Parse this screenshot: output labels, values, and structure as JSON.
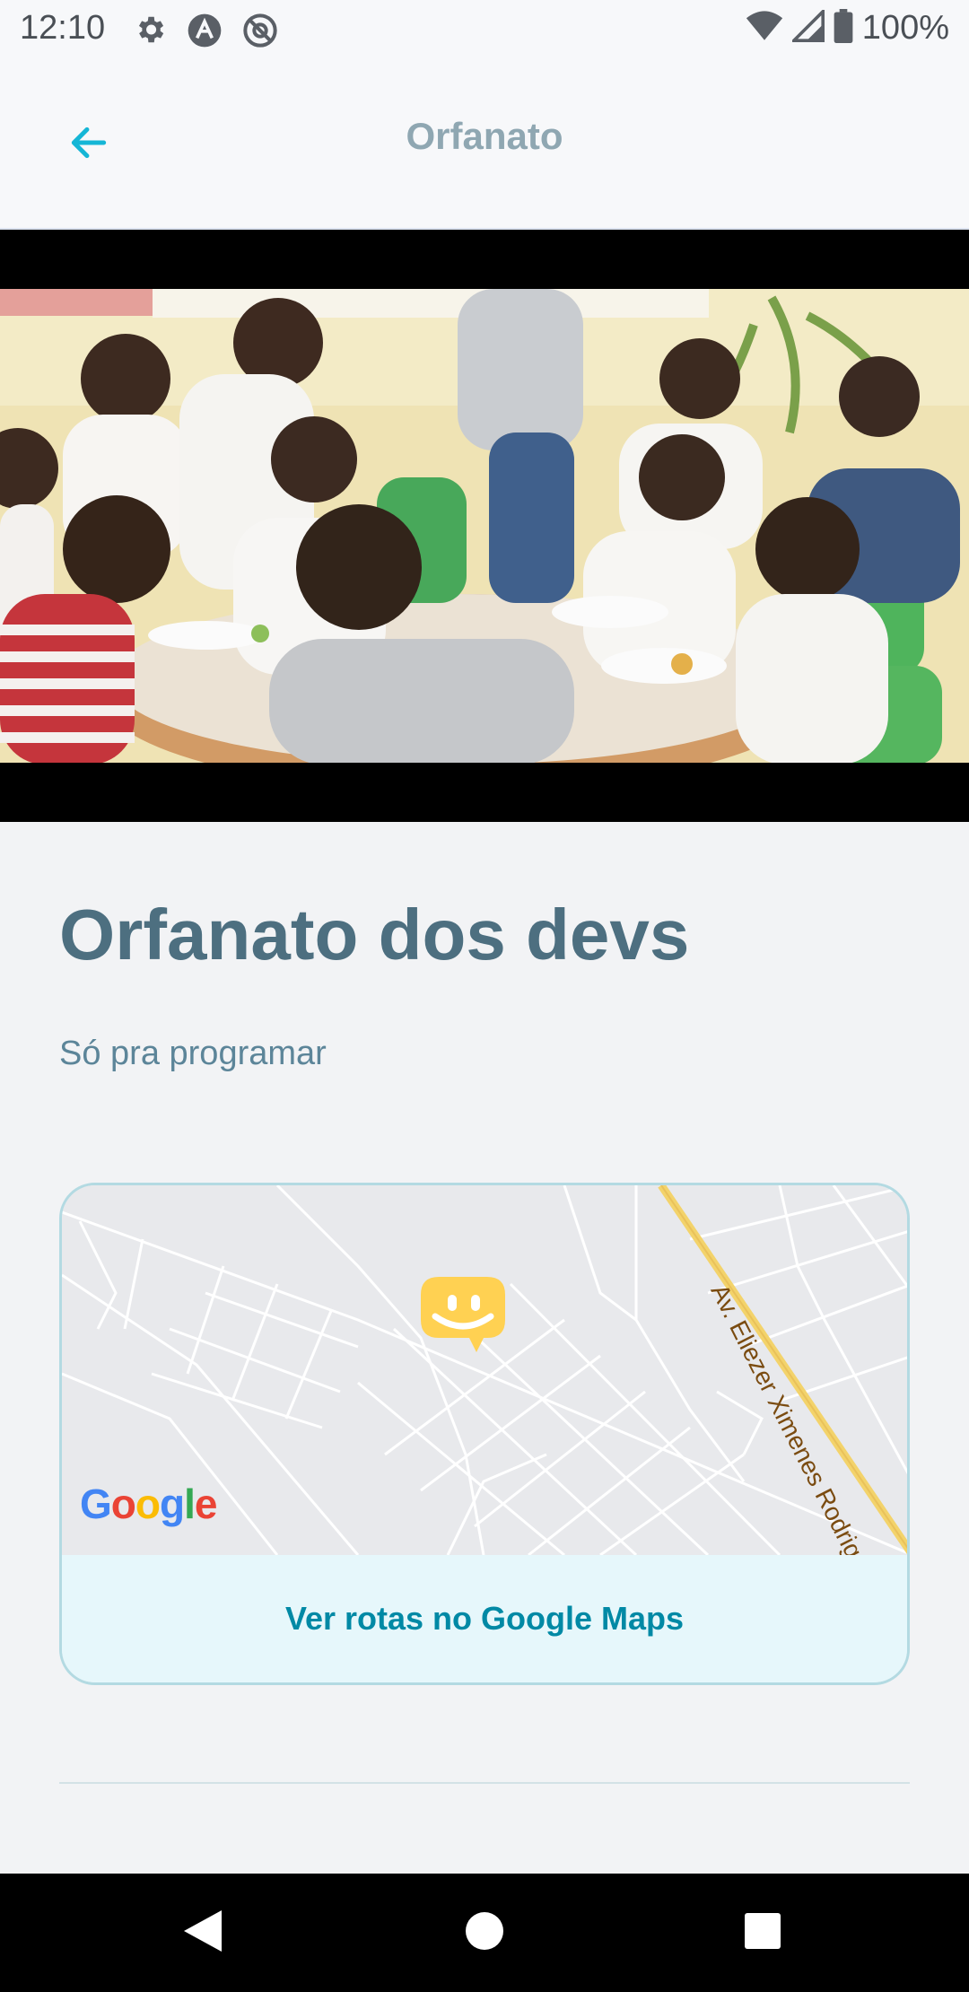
{
  "status_bar": {
    "time": "12:10",
    "battery": "100%",
    "icons": [
      "settings-icon",
      "app-a-icon",
      "app-at-icon",
      "wifi-icon",
      "signal-icon",
      "battery-icon"
    ]
  },
  "header": {
    "title": "Orfanato",
    "back_icon": "arrow-left-icon"
  },
  "orphanage": {
    "name": "Orfanato dos devs",
    "about": "Só pra programar"
  },
  "map": {
    "street_label": "Av. Eliezer Ximenes Rodrigues",
    "provider_logo": "Google",
    "marker_icon": "happy-marker-icon",
    "link_label": "Ver rotas no Google Maps"
  },
  "nav": {
    "back": "nav-back-icon",
    "home": "nav-home-icon",
    "recents": "nav-recents-icon"
  },
  "colors": {
    "title": "#4d6f80",
    "accent": "#15b6d6",
    "link": "#0089a5",
    "marker": "#ffd152"
  }
}
